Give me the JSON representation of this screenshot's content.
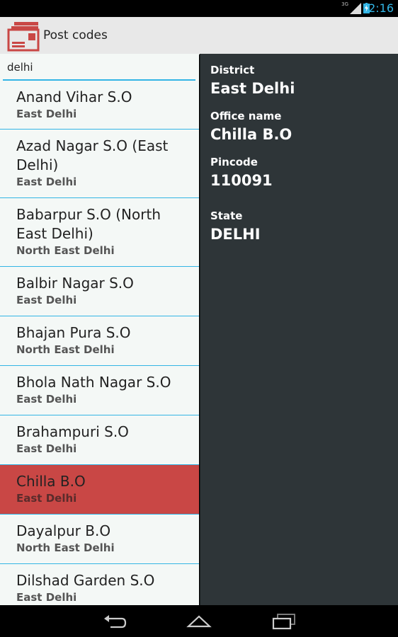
{
  "status": {
    "time": "2:16",
    "network": "3G"
  },
  "app": {
    "title": "Post codes"
  },
  "search": {
    "value": "delhi"
  },
  "list": [
    {
      "name": "Anand Vihar S.O",
      "district": "East Delhi"
    },
    {
      "name": "Azad Nagar S.O (East Delhi)",
      "district": "East Delhi"
    },
    {
      "name": "Babarpur S.O (North East Delhi)",
      "district": "North East Delhi"
    },
    {
      "name": "Balbir Nagar S.O",
      "district": "East Delhi"
    },
    {
      "name": "Bhajan Pura S.O",
      "district": "North East Delhi"
    },
    {
      "name": "Bhola Nath Nagar S.O",
      "district": "East Delhi"
    },
    {
      "name": "Brahampuri S.O",
      "district": "East Delhi"
    },
    {
      "name": "Chilla B.O",
      "district": "East Delhi"
    },
    {
      "name": "Dayalpur B.O",
      "district": "North East Delhi"
    },
    {
      "name": "Dilshad Garden S.O",
      "district": "East Delhi"
    }
  ],
  "detail": {
    "district_label": "District",
    "district_value": "East Delhi",
    "office_label": "Office name",
    "office_value": "Chilla B.O",
    "pincode_label": "Pincode",
    "pincode_value": "110091",
    "state_label": "State",
    "state_value": "DELHI"
  },
  "colors": {
    "accent": "#33b5e5",
    "selected": "#c94745",
    "detail_bg": "#2e3538"
  },
  "icons": [
    "post-box-icon",
    "signal-icon",
    "battery-icon",
    "back-icon",
    "home-icon",
    "recents-icon"
  ]
}
